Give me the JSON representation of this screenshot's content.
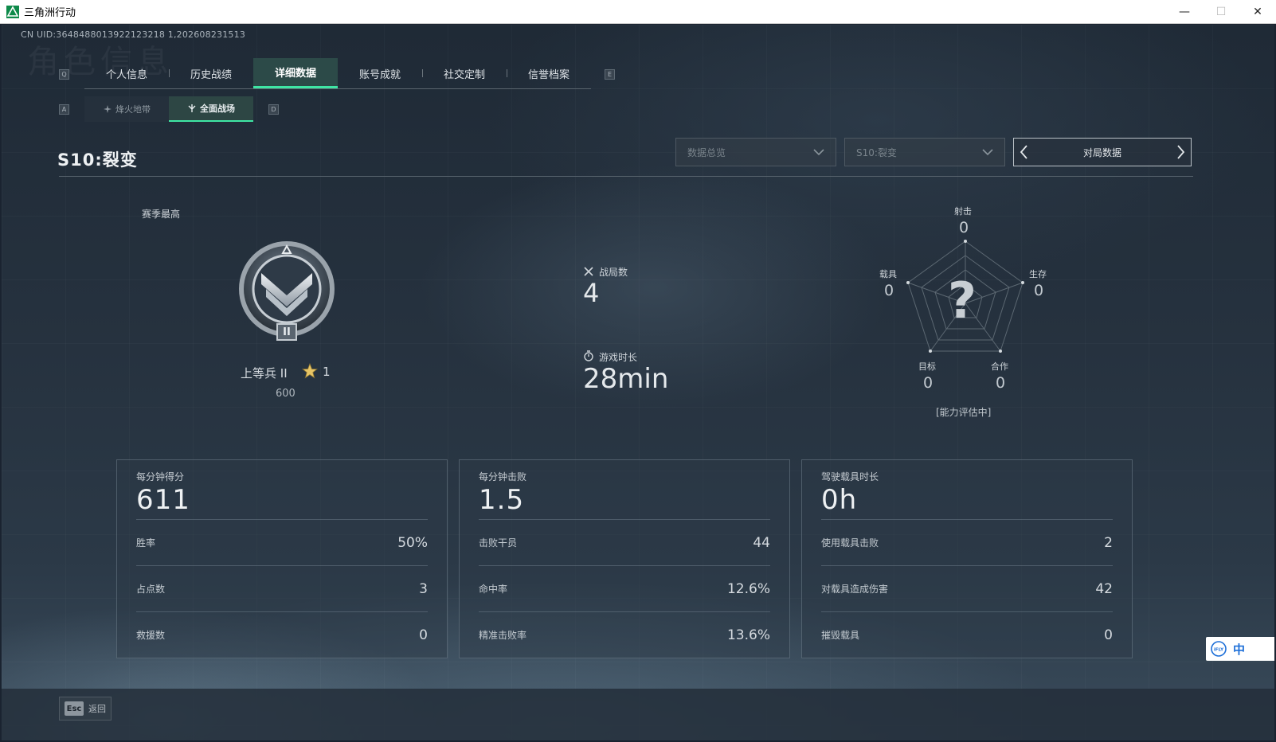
{
  "window": {
    "title": "三角洲行动",
    "minimize": "—",
    "maximize": "☐",
    "close": "✕"
  },
  "uid_text": "CN UID:3648488013922123218 1,202608231513",
  "watermark": "角色信息",
  "keys": {
    "prev_tab": "Q",
    "next_tab": "E",
    "prev_sub": "A",
    "next_sub": "D"
  },
  "tabs": [
    {
      "label": "个人信息",
      "active": false
    },
    {
      "label": "历史战绩",
      "active": false
    },
    {
      "label": "详细数据",
      "active": true
    },
    {
      "label": "账号成就",
      "active": false
    },
    {
      "label": "社交定制",
      "active": false
    },
    {
      "label": "信誉档案",
      "active": false
    }
  ],
  "subtabs": [
    {
      "label": "烽火地带",
      "active": false,
      "icon": "flame-zone-icon"
    },
    {
      "label": "全面战场",
      "active": true,
      "icon": "battlefield-icon"
    }
  ],
  "season_title": "S10:裂变",
  "filters": {
    "data_type": "数据总览",
    "season": "S10:裂变",
    "mode": "对局数据"
  },
  "rank": {
    "section_label": "赛季最高",
    "name": "上等兵 II",
    "stars": "1",
    "score": "600",
    "badge_numeral": "II"
  },
  "summary": {
    "matches_label": "战局数",
    "matches_value": "4",
    "playtime_label": "游戏时长",
    "playtime_value": "28min"
  },
  "radar": {
    "status": "[能力评估中]",
    "placeholder": "?",
    "axes": [
      {
        "label": "射击",
        "value": "0"
      },
      {
        "label": "生存",
        "value": "0"
      },
      {
        "label": "合作",
        "value": "0"
      },
      {
        "label": "目标",
        "value": "0"
      },
      {
        "label": "载具",
        "value": "0"
      }
    ]
  },
  "panels": [
    {
      "head_label": "每分钟得分",
      "head_value": "611",
      "rows": [
        {
          "label": "胜率",
          "value": "50%"
        },
        {
          "label": "占点数",
          "value": "3"
        },
        {
          "label": "救援数",
          "value": "0"
        }
      ]
    },
    {
      "head_label": "每分钟击败",
      "head_value": "1.5",
      "rows": [
        {
          "label": "击败干员",
          "value": "44"
        },
        {
          "label": "命中率",
          "value": "12.6%"
        },
        {
          "label": "精准击败率",
          "value": "13.6%"
        }
      ]
    },
    {
      "head_label": "驾驶载具时长",
      "head_value": "0h",
      "rows": [
        {
          "label": "使用载具击败",
          "value": "2"
        },
        {
          "label": "对载具造成伤害",
          "value": "42"
        },
        {
          "label": "摧毁载具",
          "value": "0"
        }
      ]
    }
  ],
  "back": {
    "key": "Esc",
    "label": "返回"
  },
  "ime": {
    "mode": "中",
    "logo_text": "iFLY"
  },
  "colors": {
    "accent": "#3ee6a4",
    "active_tab_bg": "#2c4a48"
  }
}
